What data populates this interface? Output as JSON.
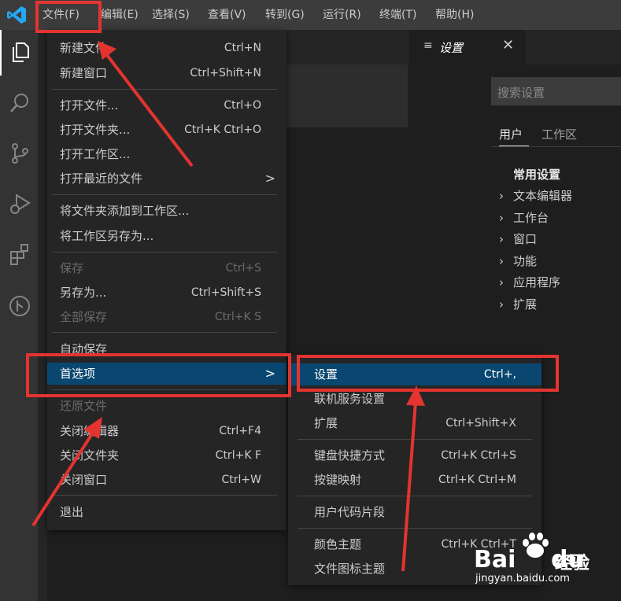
{
  "menubar": {
    "items": [
      "文件(F)",
      "编辑(E)",
      "选择(S)",
      "查看(V)",
      "转到(G)",
      "运行(R)",
      "终端(T)",
      "帮助(H)"
    ]
  },
  "activity_bar": {
    "icons": [
      "explorer-icon",
      "search-icon",
      "source-control-icon",
      "run-debug-icon",
      "extensions-icon",
      "remote-icon"
    ]
  },
  "editor_tab": {
    "icon": "settings-file-icon",
    "label": "设置",
    "close": "✕"
  },
  "settings": {
    "search_placeholder": "搜索设置",
    "scope_tabs": [
      "用户",
      "工作区"
    ],
    "toc_heading": "常用设置",
    "toc_items": [
      "文本编辑器",
      "工作台",
      "窗口",
      "功能",
      "应用程序",
      "扩展"
    ],
    "chevron": "›"
  },
  "file_menu": {
    "items": [
      {
        "label": "新建文件",
        "key": "Ctrl+N"
      },
      {
        "label": "新建窗口",
        "key": "Ctrl+Shift+N"
      },
      {
        "label": "打开文件...",
        "key": "Ctrl+O"
      },
      {
        "label": "打开文件夹...",
        "key": "Ctrl+K Ctrl+O"
      },
      {
        "label": "打开工作区...",
        "key": ""
      },
      {
        "label": "打开最近的文件",
        "key": "",
        "submenu": ">"
      },
      {
        "label": "将文件夹添加到工作区...",
        "key": ""
      },
      {
        "label": "将工作区另存为...",
        "key": ""
      },
      {
        "label": "保存",
        "key": "Ctrl+S"
      },
      {
        "label": "另存为...",
        "key": "Ctrl+Shift+S"
      },
      {
        "label": "全部保存",
        "key": "Ctrl+K S"
      },
      {
        "label": "自动保存",
        "key": ""
      },
      {
        "label": "首选项",
        "key": "",
        "submenu": ">"
      },
      {
        "label": "还原文件",
        "key": ""
      },
      {
        "label": "关闭编辑器",
        "key": "Ctrl+F4"
      },
      {
        "label": "关闭文件夹",
        "key": "Ctrl+K F"
      },
      {
        "label": "关闭窗口",
        "key": "Ctrl+W"
      },
      {
        "label": "退出",
        "key": ""
      }
    ]
  },
  "preferences_menu": {
    "items": [
      {
        "label": "设置",
        "key": "Ctrl+,"
      },
      {
        "label": "联机服务设置",
        "key": ""
      },
      {
        "label": "扩展",
        "key": "Ctrl+Shift+X"
      },
      {
        "label": "键盘快捷方式",
        "key": "Ctrl+K Ctrl+S"
      },
      {
        "label": "按键映射",
        "key": "Ctrl+K Ctrl+M"
      },
      {
        "label": "用户代码片段",
        "key": ""
      },
      {
        "label": "颜色主题",
        "key": "Ctrl+K Ctrl+T"
      },
      {
        "label": "文件图标主题",
        "key": ""
      }
    ]
  },
  "watermark": {
    "brand": "Bai",
    "brand2": "du",
    "cn": "经验",
    "url": "jingyan.baidu.com"
  },
  "colors": {
    "accent_selected": "#094771",
    "highlight_red": "#e3342f",
    "menu_bg": "#252526",
    "vscode_blue": "#23a9f2"
  }
}
